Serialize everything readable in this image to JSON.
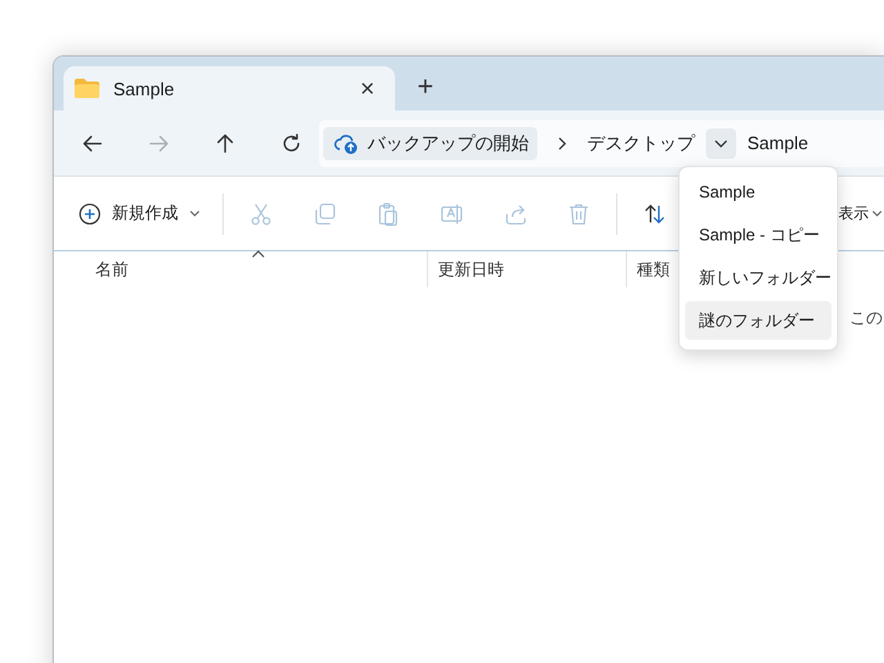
{
  "tab": {
    "title": "Sample",
    "close": "×",
    "new_tab": "+"
  },
  "nav": [
    {
      "kind": "back",
      "disabled": false
    },
    {
      "kind": "forward",
      "disabled": true
    },
    {
      "kind": "up",
      "disabled": false
    },
    {
      "kind": "refresh",
      "disabled": false
    }
  ],
  "breadcrumb": {
    "backup_label": "バックアップの開始",
    "segments": [
      "デスクトップ",
      "Sample"
    ],
    "dropdown_expanded": true
  },
  "toolbar": {
    "new_label": "新規作成",
    "tools": [
      {
        "kind": "cut",
        "disabled": true
      },
      {
        "kind": "copy",
        "disabled": true
      },
      {
        "kind": "paste",
        "disabled": true
      },
      {
        "kind": "rename",
        "disabled": true
      },
      {
        "kind": "share",
        "disabled": true
      },
      {
        "kind": "delete",
        "disabled": true
      }
    ],
    "view_label": "表示"
  },
  "columns": [
    {
      "label": "名前",
      "sorted": true
    },
    {
      "label": "更新日時",
      "sorted": false
    },
    {
      "label": "種類",
      "sorted": false
    }
  ],
  "empty_message": "この",
  "menu": [
    {
      "label": "Sample",
      "selected": false
    },
    {
      "label": "Sample - コピー",
      "selected": false
    },
    {
      "label": "新しいフォルダー",
      "selected": false
    },
    {
      "label": "謎のフォルダー",
      "selected": true
    }
  ]
}
